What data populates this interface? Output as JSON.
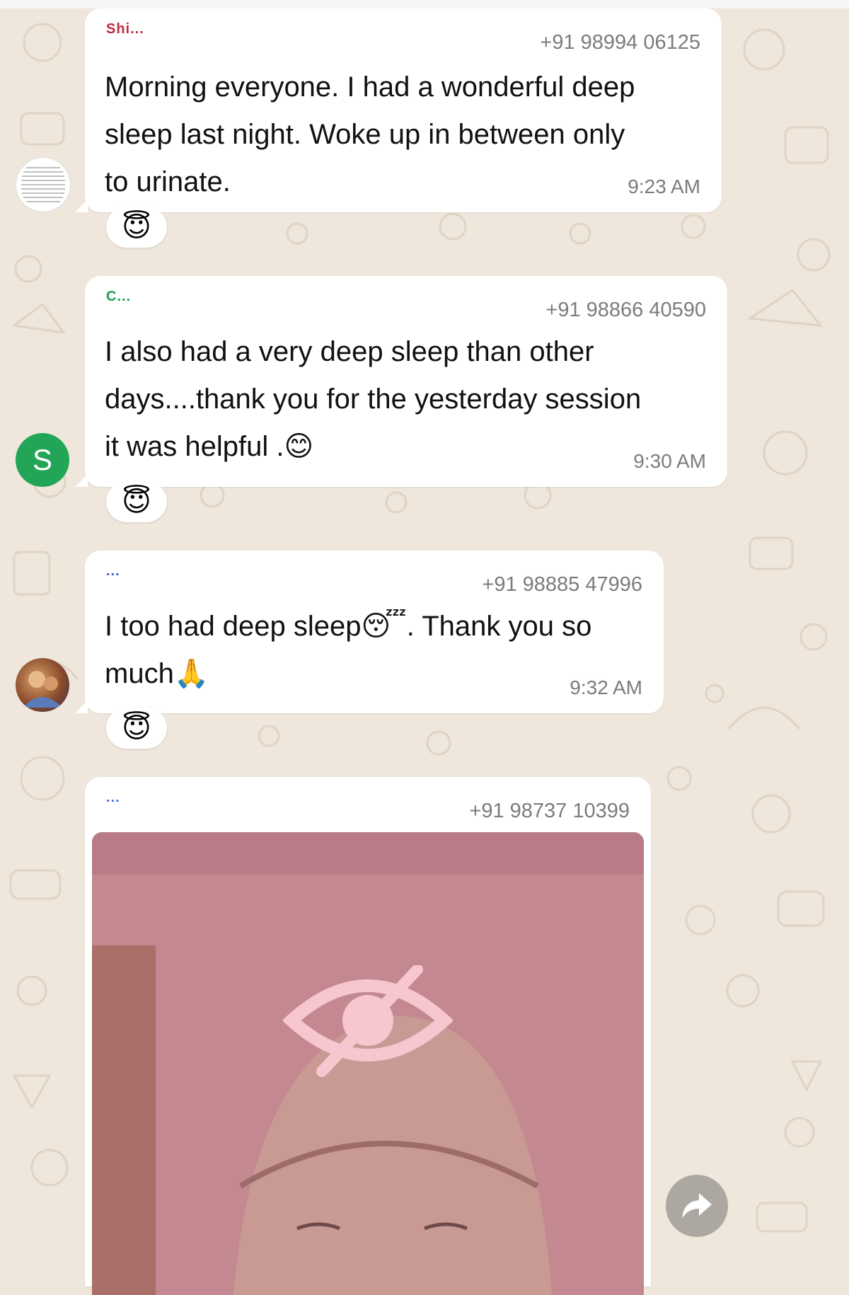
{
  "messages": [
    {
      "name": "Shi...",
      "name_color": "#c0283f",
      "phone": "+91 98994 06125",
      "text_lines": [
        "Morning everyone. I had a wonderful deep",
        "sleep last night. Woke up in between only",
        "to urinate."
      ],
      "time": "9:23 AM",
      "reaction": "😇"
    },
    {
      "name": "C...",
      "name_color": "#1f9d55",
      "phone": "+91 98866 40590",
      "text_lines": [
        "I also had a very deep sleep than other",
        "days....thank you for the yesterday session",
        "it was helpful ."
      ],
      "trailing_emoji": "😊",
      "time": "9:30 AM",
      "avatar_letter": "S",
      "avatar_color": "#22a557",
      "reaction": "😇"
    },
    {
      "name": "...",
      "name_color": "#3b5bdb",
      "phone": "+91 98885 47996",
      "line1_pre": "I too had deep sleep",
      "line1_emoji": "😴",
      "line1_post": ". Thank you so",
      "line2": "much",
      "line2_emoji": "🙏",
      "time": "9:32 AM",
      "reaction": "😇"
    },
    {
      "name": "...",
      "name_color": "#4c6ef5",
      "phone": "+91 98737 10399",
      "media": "hidden-photo",
      "media_icon": "eye-off-icon"
    }
  ],
  "forward_icon": "forward-icon",
  "accent_colors": {
    "wallpaper": "#efe7dc",
    "bubble": "#ffffff",
    "timestamp": "#7c7c7c",
    "media_overlay": "#c1838d"
  }
}
